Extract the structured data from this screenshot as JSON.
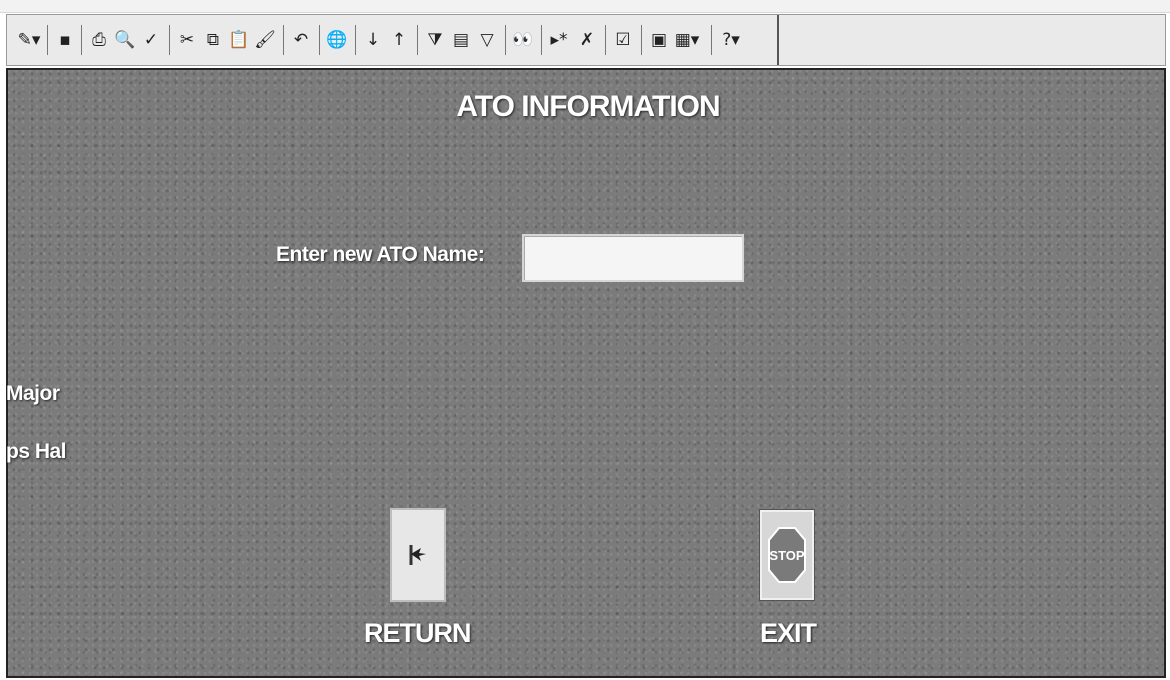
{
  "toolbar": {
    "buttons": [
      {
        "name": "view-design-button",
        "glyph": "✎▾"
      },
      {
        "name": "save-button",
        "glyph": "▪"
      },
      {
        "name": "print-button",
        "glyph": "⎙"
      },
      {
        "name": "print-preview-button",
        "glyph": "🔍"
      },
      {
        "name": "spelling-button",
        "glyph": "✓"
      },
      {
        "name": "cut-button",
        "glyph": "✂"
      },
      {
        "name": "copy-button",
        "glyph": "⧉"
      },
      {
        "name": "paste-button",
        "glyph": "📋"
      },
      {
        "name": "format-painter-button",
        "glyph": "🖌"
      },
      {
        "name": "undo-button",
        "glyph": "↶"
      },
      {
        "name": "insert-hyperlink-button",
        "glyph": "🌐"
      },
      {
        "name": "sort-ascending-button",
        "glyph": "↓"
      },
      {
        "name": "sort-descending-button",
        "glyph": "↑"
      },
      {
        "name": "filter-by-selection-button",
        "glyph": "⧩"
      },
      {
        "name": "filter-by-form-button",
        "glyph": "▤"
      },
      {
        "name": "apply-filter-button",
        "glyph": "▽"
      },
      {
        "name": "find-button",
        "glyph": "👀"
      },
      {
        "name": "new-record-button",
        "glyph": "▸*"
      },
      {
        "name": "delete-record-button",
        "glyph": "✗"
      },
      {
        "name": "properties-button",
        "glyph": "☑"
      },
      {
        "name": "database-window-button",
        "glyph": "▣"
      },
      {
        "name": "new-object-button",
        "glyph": "▦▾"
      },
      {
        "name": "help-button",
        "glyph": "?▾"
      }
    ]
  },
  "form": {
    "title": "ATO INFORMATION",
    "ato_name_label": "Enter new ATO Name:",
    "ato_name_value": "",
    "side_text_1": "Major",
    "side_text_2": "ps Hal",
    "return_label": "RETURN",
    "exit_label": "EXIT",
    "exit_icon_text": "STOP"
  },
  "colors": {
    "background_texture": "#7b7b7b",
    "text": "#ffffff",
    "stop_sign": "#7a7a7a"
  }
}
